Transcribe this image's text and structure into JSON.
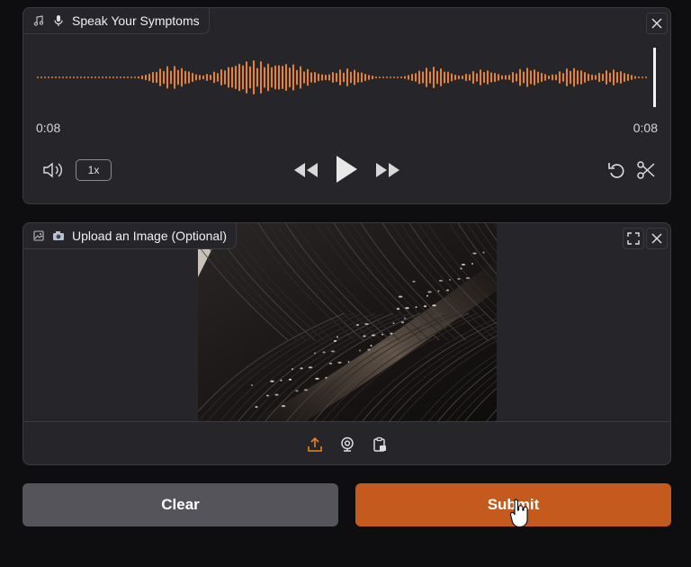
{
  "audio": {
    "label": "Speak Your Symptoms",
    "time_current": "0:08",
    "time_total": "0:08",
    "speed": "1x",
    "accent_color": "#e8832a"
  },
  "image": {
    "label": "Upload an Image (Optional)"
  },
  "buttons": {
    "clear": "Clear",
    "submit": "Submit"
  },
  "colors": {
    "panel": "#26262a",
    "submit": "#c45a1e",
    "clear": "#54545a"
  },
  "icons": {
    "music": "music-note-icon",
    "mic": "microphone-icon",
    "close": "close-icon",
    "volume": "volume-icon",
    "rewind": "rewind-icon",
    "play": "play-icon",
    "forward": "fast-forward-icon",
    "undo": "undo-icon",
    "trim": "scissors-icon",
    "image": "image-icon",
    "fullscreen": "fullscreen-icon",
    "upload": "upload-icon",
    "webcam": "webcam-icon",
    "clipboard": "clipboard-icon"
  }
}
